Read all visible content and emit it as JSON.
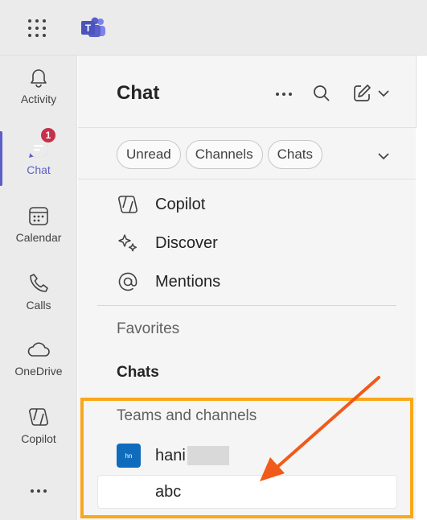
{
  "app": {
    "logo_letter": "T",
    "logo_color": "#5b5fc7"
  },
  "rail": {
    "items": [
      {
        "label": "Activity",
        "icon": "bell-icon"
      },
      {
        "label": "Chat",
        "icon": "chat-icon",
        "badge": "1",
        "active": true
      },
      {
        "label": "Calendar",
        "icon": "calendar-icon"
      },
      {
        "label": "Calls",
        "icon": "phone-icon"
      },
      {
        "label": "OneDrive",
        "icon": "cloud-icon"
      },
      {
        "label": "Copilot",
        "icon": "copilot-icon"
      }
    ]
  },
  "chat": {
    "title": "Chat",
    "filters": [
      "Unread",
      "Channels",
      "Chats"
    ],
    "nav": [
      {
        "label": "Copilot",
        "icon": "copilot-icon"
      },
      {
        "label": "Discover",
        "icon": "sparkle-icon"
      },
      {
        "label": "Mentions",
        "icon": "at-icon"
      }
    ],
    "sections": {
      "favorites": "Favorites",
      "chats": "Chats",
      "teams": "Teams and channels"
    },
    "team": {
      "avatar": "hn",
      "name": "hani"
    },
    "channel": {
      "name": "abc"
    }
  },
  "colors": {
    "accent": "#5b5fc7",
    "badge": "#c4314b",
    "highlight": "#f9a81a",
    "arrow": "#f05a1a"
  }
}
